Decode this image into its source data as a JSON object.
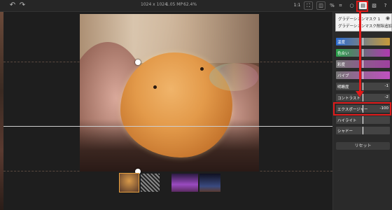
{
  "topbar": {
    "undo_icon": "undo-icon",
    "redo_icon": "redo-icon",
    "dimensions": "1024 x 1024",
    "megapixels": "1.05 MP",
    "zoom": "62.4%",
    "fit_label": "1:1",
    "help_label": "?"
  },
  "photo": {
    "description_icon": "photo-canvas"
  },
  "filmstrip": {
    "thumbnails": [
      {
        "name": "egg-thumb",
        "colors": [
          "#d89a4a",
          "#5a3a2a"
        ],
        "selected": true
      },
      {
        "name": "bw-thumb",
        "colors": [
          "#888",
          "#222"
        ],
        "selected": false
      },
      {
        "name": "purple-thumb",
        "colors": [
          "#9a4ac0",
          "#2a1a40"
        ],
        "selected": false
      },
      {
        "name": "night-thumb",
        "colors": [
          "#3a4a80",
          "#101020"
        ],
        "selected": false
      }
    ]
  },
  "panel": {
    "dropdown_items": [
      "グラデーションマスク 1",
      "グラデーションマスク削除追加"
    ],
    "sliders": [
      {
        "label": "温度",
        "value": "",
        "colors": [
          "#2a6ad0",
          "#c89a3a"
        ]
      },
      {
        "label": "色合い",
        "value": "",
        "colors": [
          "#2aa04a",
          "#b03ab0"
        ]
      },
      {
        "label": "彩度",
        "value": "",
        "colors": [
          "#777777",
          "#a040a0"
        ]
      },
      {
        "label": "バイブ",
        "value": "",
        "colors": [
          "#777777",
          "#c050c0"
        ]
      },
      {
        "label": "明瞭度",
        "value": "-1",
        "colors": [
          "#444444",
          "#444444"
        ]
      },
      {
        "label": "コントラスト",
        "value": "-2",
        "colors": [
          "#444444",
          "#444444"
        ]
      },
      {
        "label": "エクスポージャー",
        "value": "-100",
        "colors": [
          "#444444",
          "#444444"
        ]
      },
      {
        "label": "ハイライト",
        "value": "",
        "colors": [
          "#444444",
          "#444444"
        ]
      },
      {
        "label": "シャドー",
        "value": "",
        "colors": [
          "#444444",
          "#444444"
        ]
      }
    ],
    "reset_label": "リセット"
  },
  "accent": "#e01a1a"
}
